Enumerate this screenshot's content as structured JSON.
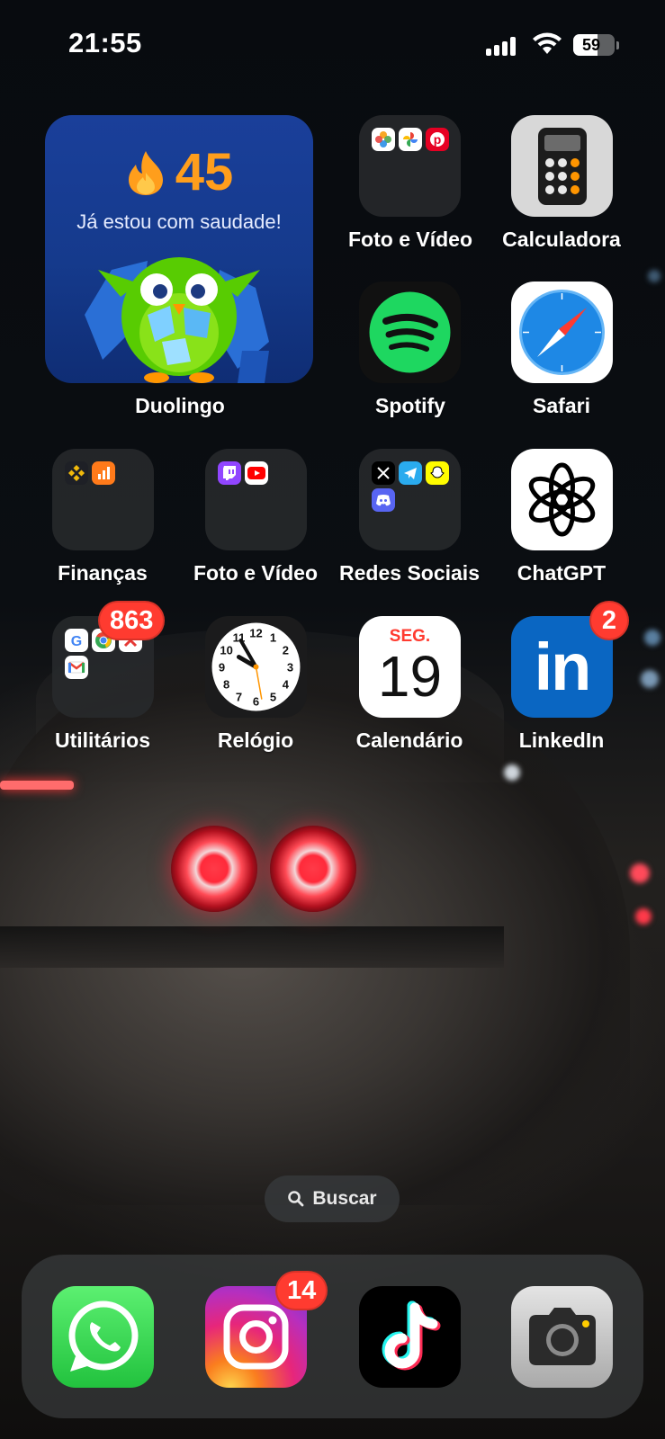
{
  "status_bar": {
    "time": "21:55",
    "battery_percent": "59",
    "battery_level": 0.59
  },
  "widget": {
    "streak_count": "45",
    "message": "Já estou com saudade!",
    "label": "Duolingo",
    "accent": "#ff9e1c"
  },
  "apps": {
    "foto_video_1": "Foto e Vídeo",
    "calculadora": "Calculadora",
    "spotify": "Spotify",
    "safari": "Safari",
    "financas": "Finanças",
    "foto_video_2": "Foto e Vídeo",
    "redes_sociais": "Redes Sociais",
    "chatgpt": "ChatGPT",
    "utilitarios": "Utilitários",
    "relogio": "Relógio",
    "calendario": "Calendário",
    "linkedin": "LinkedIn"
  },
  "badges": {
    "utilitarios": "863",
    "linkedin": "2",
    "instagram": "14"
  },
  "calendar": {
    "weekday": "SEG.",
    "day": "19"
  },
  "clock_numbers": [
    "12",
    "1",
    "2",
    "3",
    "4",
    "5",
    "6",
    "7",
    "8",
    "9",
    "10",
    "11"
  ],
  "linkedin_mark": "in",
  "search": {
    "label": "Buscar"
  },
  "dock": [
    "whatsapp",
    "instagram",
    "tiktok",
    "camera"
  ],
  "colors": {
    "badge": "#ff3b30",
    "spotify": "#1ed760",
    "linkedin": "#0a66c2",
    "whatsapp": "#25d366"
  }
}
